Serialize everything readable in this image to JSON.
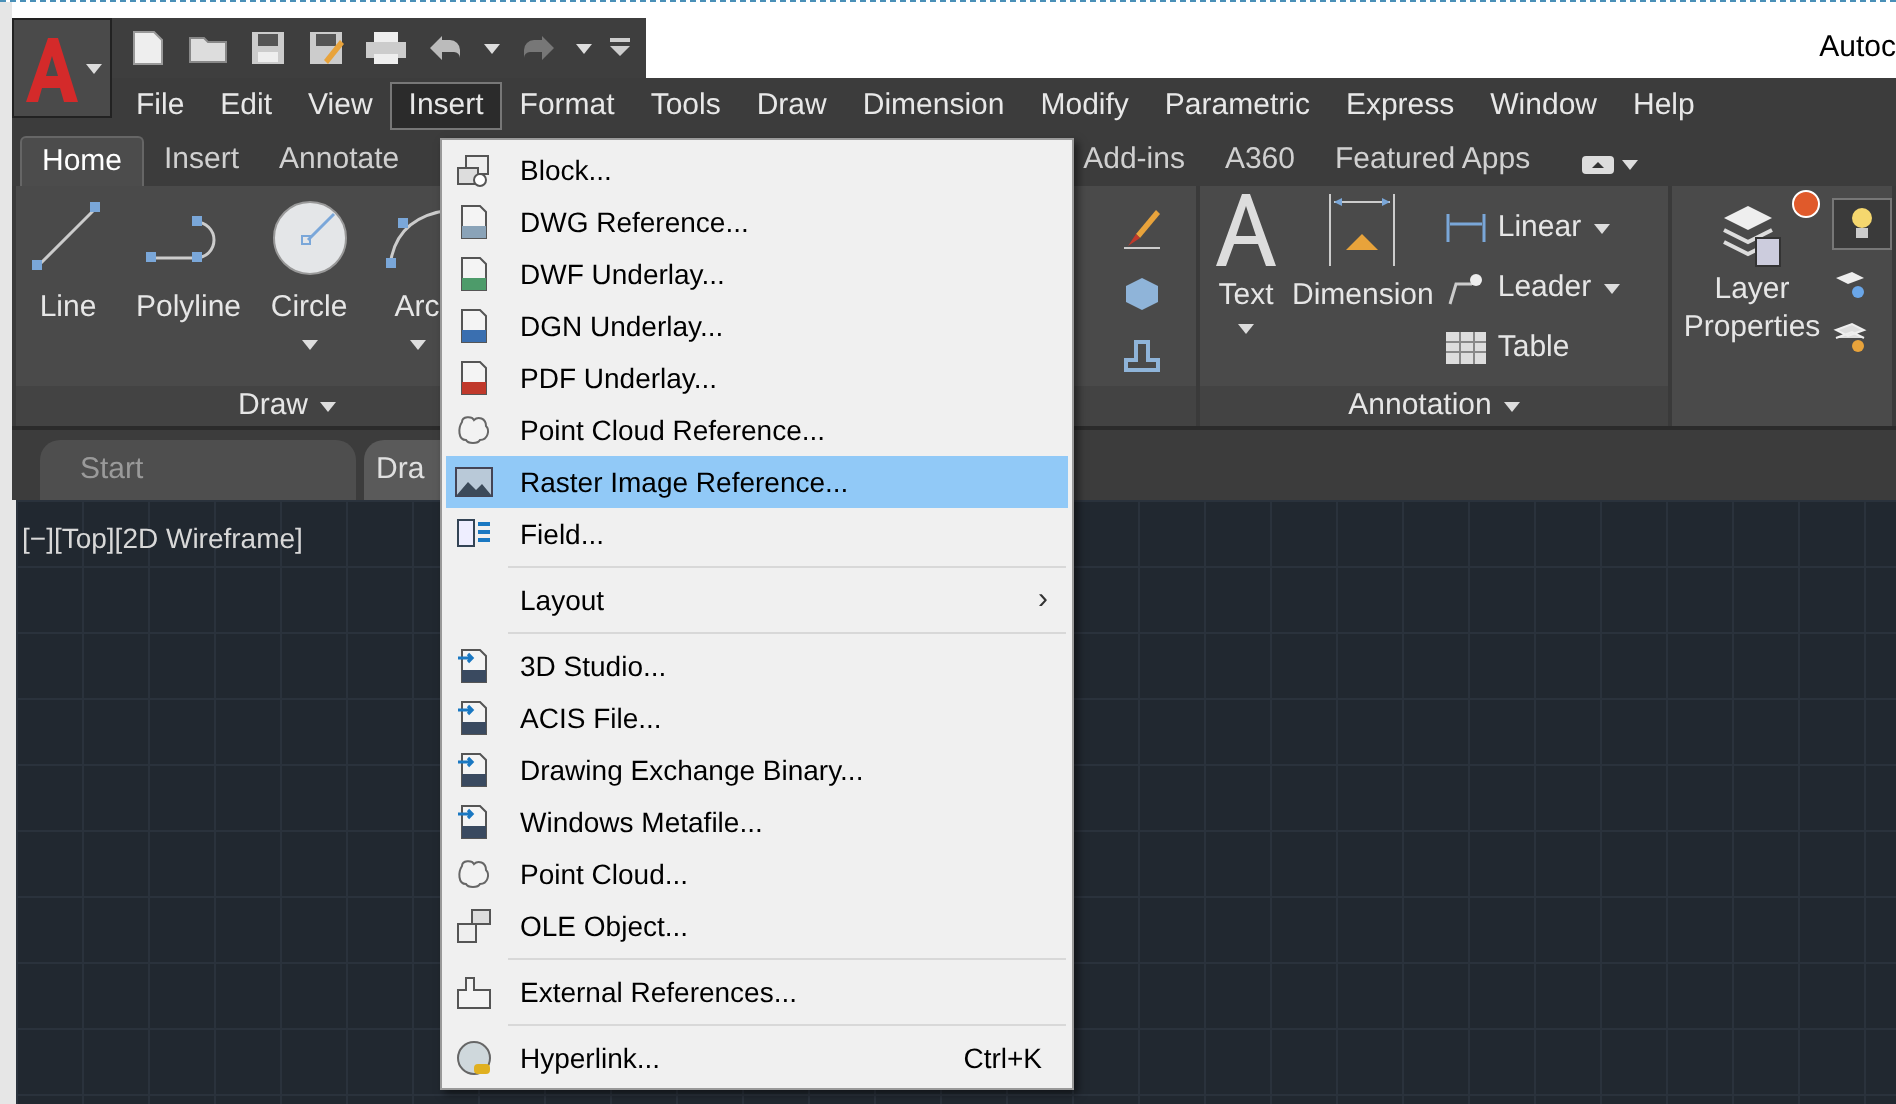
{
  "app_title": "Autoc",
  "menu_bar": [
    {
      "label": "File",
      "selected": false
    },
    {
      "label": "Edit",
      "selected": false
    },
    {
      "label": "View",
      "selected": false
    },
    {
      "label": "Insert",
      "selected": true
    },
    {
      "label": "Format",
      "selected": false
    },
    {
      "label": "Tools",
      "selected": false
    },
    {
      "label": "Draw",
      "selected": false
    },
    {
      "label": "Dimension",
      "selected": false
    },
    {
      "label": "Modify",
      "selected": false
    },
    {
      "label": "Parametric",
      "selected": false
    },
    {
      "label": "Express",
      "selected": false
    },
    {
      "label": "Window",
      "selected": false
    },
    {
      "label": "Help",
      "selected": false
    }
  ],
  "ribbon_tabs": [
    {
      "label": "Home",
      "selected": true
    },
    {
      "label": "Insert",
      "selected": false
    },
    {
      "label": "Annotate",
      "selected": false
    },
    {
      "label": "Add-ins",
      "selected": false
    },
    {
      "label": "A360",
      "selected": false
    },
    {
      "label": "Featured Apps",
      "selected": false
    }
  ],
  "draw_panel": {
    "title": "Draw",
    "tools": [
      {
        "label": "Line",
        "dropdown": false
      },
      {
        "label": "Polyline",
        "dropdown": false
      },
      {
        "label": "Circle",
        "dropdown": true
      },
      {
        "label": "Arc",
        "dropdown": true
      }
    ]
  },
  "annotation_panel": {
    "title": "Annotation",
    "large_tools": [
      {
        "label": "Text",
        "dropdown": true
      },
      {
        "label": "Dimension",
        "dropdown": false
      }
    ],
    "small_tools": [
      {
        "label": "Linear",
        "dropdown": true
      },
      {
        "label": "Leader",
        "dropdown": true
      },
      {
        "label": "Table",
        "dropdown": false
      }
    ]
  },
  "layers_panel": {
    "tool": "Layer Properties"
  },
  "file_tabs": [
    {
      "label": "Start",
      "selected": false
    },
    {
      "label": "Dra",
      "selected": true
    }
  ],
  "viewport_label": "[−][Top][2D Wireframe]",
  "insert_menu": [
    {
      "kind": "item",
      "label": "Block...",
      "selected": false
    },
    {
      "kind": "item",
      "label": "DWG Reference...",
      "selected": false
    },
    {
      "kind": "item",
      "label": "DWF Underlay...",
      "selected": false
    },
    {
      "kind": "item",
      "label": "DGN Underlay...",
      "selected": false
    },
    {
      "kind": "item",
      "label": "PDF Underlay...",
      "selected": false
    },
    {
      "kind": "item",
      "label": "Point Cloud Reference...",
      "selected": false
    },
    {
      "kind": "item",
      "label": "Raster Image Reference...",
      "selected": true
    },
    {
      "kind": "item",
      "label": "Field...",
      "selected": false
    },
    {
      "kind": "separator"
    },
    {
      "kind": "submenu",
      "label": "Layout",
      "selected": false,
      "arrow": "›"
    },
    {
      "kind": "separator"
    },
    {
      "kind": "item",
      "label": "3D Studio...",
      "selected": false
    },
    {
      "kind": "item",
      "label": "ACIS File...",
      "selected": false
    },
    {
      "kind": "item",
      "label": "Drawing Exchange Binary...",
      "selected": false
    },
    {
      "kind": "item",
      "label": "Windows Metafile...",
      "selected": false
    },
    {
      "kind": "item",
      "label": "Point Cloud...",
      "selected": false
    },
    {
      "kind": "item",
      "label": "OLE Object...",
      "selected": false
    },
    {
      "kind": "separator"
    },
    {
      "kind": "item",
      "label": "External References...",
      "selected": false
    },
    {
      "kind": "separator"
    },
    {
      "kind": "item",
      "label": "Hyperlink...",
      "selected": false,
      "shortcut": "Ctrl+K"
    }
  ]
}
